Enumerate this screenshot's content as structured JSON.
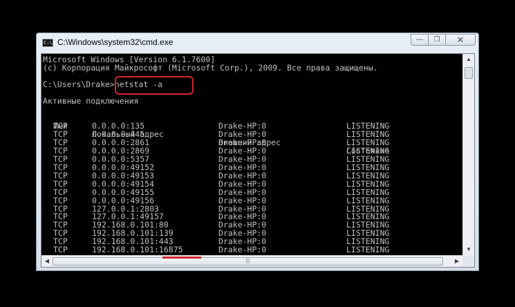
{
  "window": {
    "title": "C:\\Windows\\system32\\cmd.exe",
    "icon_text": "C:\\"
  },
  "console": {
    "header_line1": "Microsoft Windows [Version 6.1.7600]",
    "header_line2": "(c) Корпорация Майкрософт (Microsoft Corp.), 2009. Все права защищены.",
    "prompt": "C:\\Users\\Drake>",
    "command": "netstat -a",
    "section_title": "Активные подключения",
    "columns": [
      "Имя",
      "Локальный адрес",
      "Внешний адрес",
      "Состояние"
    ],
    "rows": [
      {
        "proto": "TCP",
        "local": "0.0.0.0:135",
        "foreign": "Drake-HP:0",
        "state": "LISTENING"
      },
      {
        "proto": "TCP",
        "local": "0.0.0.0:445",
        "foreign": "Drake-HP:0",
        "state": "LISTENING"
      },
      {
        "proto": "TCP",
        "local": "0.0.0.0:2861",
        "foreign": "Drake-HP:0",
        "state": "LISTENING"
      },
      {
        "proto": "TCP",
        "local": "0.0.0.0:2869",
        "foreign": "Drake-HP:0",
        "state": "LISTENING"
      },
      {
        "proto": "TCP",
        "local": "0.0.0.0:5357",
        "foreign": "Drake-HP:0",
        "state": "LISTENING"
      },
      {
        "proto": "TCP",
        "local": "0.0.0.0:49152",
        "foreign": "Drake-HP:0",
        "state": "LISTENING"
      },
      {
        "proto": "TCP",
        "local": "0.0.0.0:49153",
        "foreign": "Drake-HP:0",
        "state": "LISTENING"
      },
      {
        "proto": "TCP",
        "local": "0.0.0.0:49154",
        "foreign": "Drake-HP:0",
        "state": "LISTENING"
      },
      {
        "proto": "TCP",
        "local": "0.0.0.0:49155",
        "foreign": "Drake-HP:0",
        "state": "LISTENING"
      },
      {
        "proto": "TCP",
        "local": "0.0.0.0:49156",
        "foreign": "Drake-HP:0",
        "state": "LISTENING"
      },
      {
        "proto": "TCP",
        "local": "127.0.0.1:2803",
        "foreign": "Drake-HP:0",
        "state": "LISTENING"
      },
      {
        "proto": "TCP",
        "local": "127.0.0.1:49157",
        "foreign": "Drake-HP:0",
        "state": "LISTENING"
      },
      {
        "proto": "TCP",
        "local": "192.168.0.101:80",
        "foreign": "Drake-HP:0",
        "state": "LISTENING"
      },
      {
        "proto": "TCP",
        "local": "192.168.0.101:139",
        "foreign": "Drake-HP:0",
        "state": "LISTENING"
      },
      {
        "proto": "TCP",
        "local": "192.168.0.101:443",
        "foreign": "Drake-HP:0",
        "state": "LISTENING"
      },
      {
        "proto": "TCP",
        "local": "192.168.0.101:16875",
        "foreign": "Drake-HP:0",
        "state": "LISTENING"
      }
    ]
  },
  "colors": {
    "console_bg": "#000000",
    "console_text": "#c0c0c0",
    "highlight": "#d6242c"
  }
}
